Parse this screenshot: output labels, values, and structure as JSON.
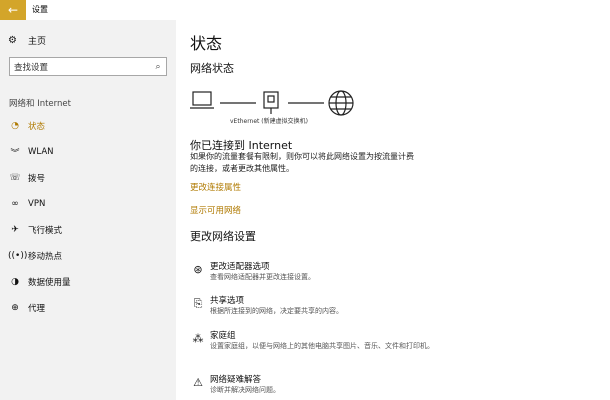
{
  "window": {
    "title": "设置",
    "back_icon": "back-arrow-icon",
    "accent": "#d3a52a"
  },
  "sidebar": {
    "home_label": "主页",
    "search_placeholder": "查找设置",
    "section_label": "网络和 Internet",
    "items": [
      {
        "label": "状态",
        "icon": "status-icon",
        "active": true
      },
      {
        "label": "WLAN",
        "icon": "wifi-icon"
      },
      {
        "label": "拨号",
        "icon": "dialup-icon"
      },
      {
        "label": "VPN",
        "icon": "vpn-icon"
      },
      {
        "label": "飞行模式",
        "icon": "airplane-icon"
      },
      {
        "label": "移动热点",
        "icon": "hotspot-icon"
      },
      {
        "label": "数据使用量",
        "icon": "data-usage-icon"
      },
      {
        "label": "代理",
        "icon": "globe-icon"
      }
    ]
  },
  "main": {
    "title": "状态",
    "network_status_heading": "网络状态",
    "adapter_name": "vEthernet (新建虚拟交换机)",
    "connected_heading": "你已连接到 Internet",
    "connected_desc": "如果你的流量套餐有限制，则你可以将此网络设置为按流量计费的连接，或者更改其他属性。",
    "links": {
      "change_props": "更改连接属性",
      "show_networks": "显示可用网络"
    },
    "change_heading": "更改网络设置",
    "options": [
      {
        "title": "更改适配器选项",
        "desc": "查看网络适配器并更改连接设置。",
        "icon": "adapter-icon"
      },
      {
        "title": "共享选项",
        "desc": "根据所连接到的网络，决定要共享的内容。",
        "icon": "sharing-icon"
      },
      {
        "title": "家庭组",
        "desc": "设置家庭组，以便与网络上的其他电脑共享图片、音乐、文件和打印机。",
        "icon": "homegroup-icon"
      },
      {
        "title": "网络疑难解答",
        "desc": "诊断并解决网络问题。",
        "icon": "warning-icon"
      }
    ]
  },
  "colors": {
    "link": "#b07a00",
    "sidebar_bg": "#f2f2f2"
  }
}
